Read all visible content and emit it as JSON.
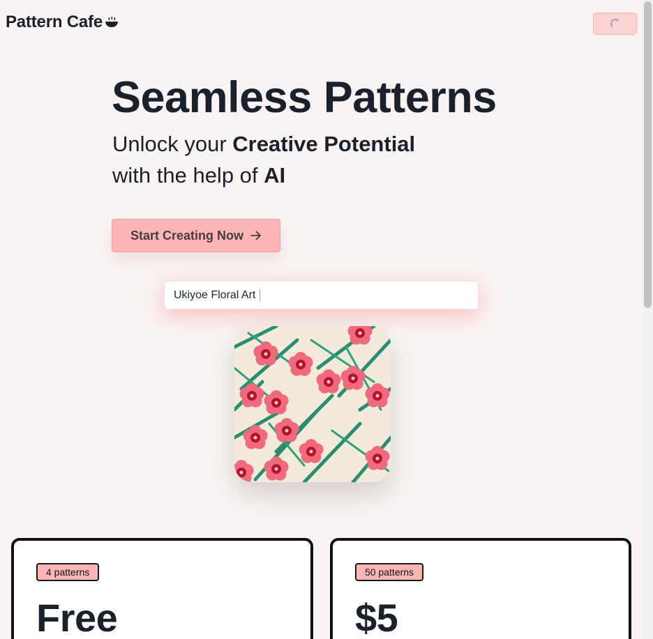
{
  "header": {
    "brand": "Pattern Cafe",
    "brand_icon": "coffee-bowl-icon",
    "loading_icon": "spinner-icon"
  },
  "hero": {
    "title": "Seamless Patterns",
    "subtitle_line1_plain": "Unlock your ",
    "subtitle_line1_bold": "Creative Potential",
    "subtitle_line2_plain": "with the help of ",
    "subtitle_line2_bold": "AI",
    "cta_label": "Start Creating Now",
    "cta_icon": "arrow-right-icon"
  },
  "prompt": {
    "value": "Ukiyoe Floral Art"
  },
  "preview": {
    "image": "ukiyoe-floral-pattern"
  },
  "pricing": [
    {
      "badge": "4 patterns",
      "price": "Free"
    },
    {
      "badge": "50 patterns",
      "price": "$5"
    }
  ],
  "colors": {
    "background": "#f9f4f3",
    "accent": "#fcb6b6",
    "text": "#1a202c"
  }
}
